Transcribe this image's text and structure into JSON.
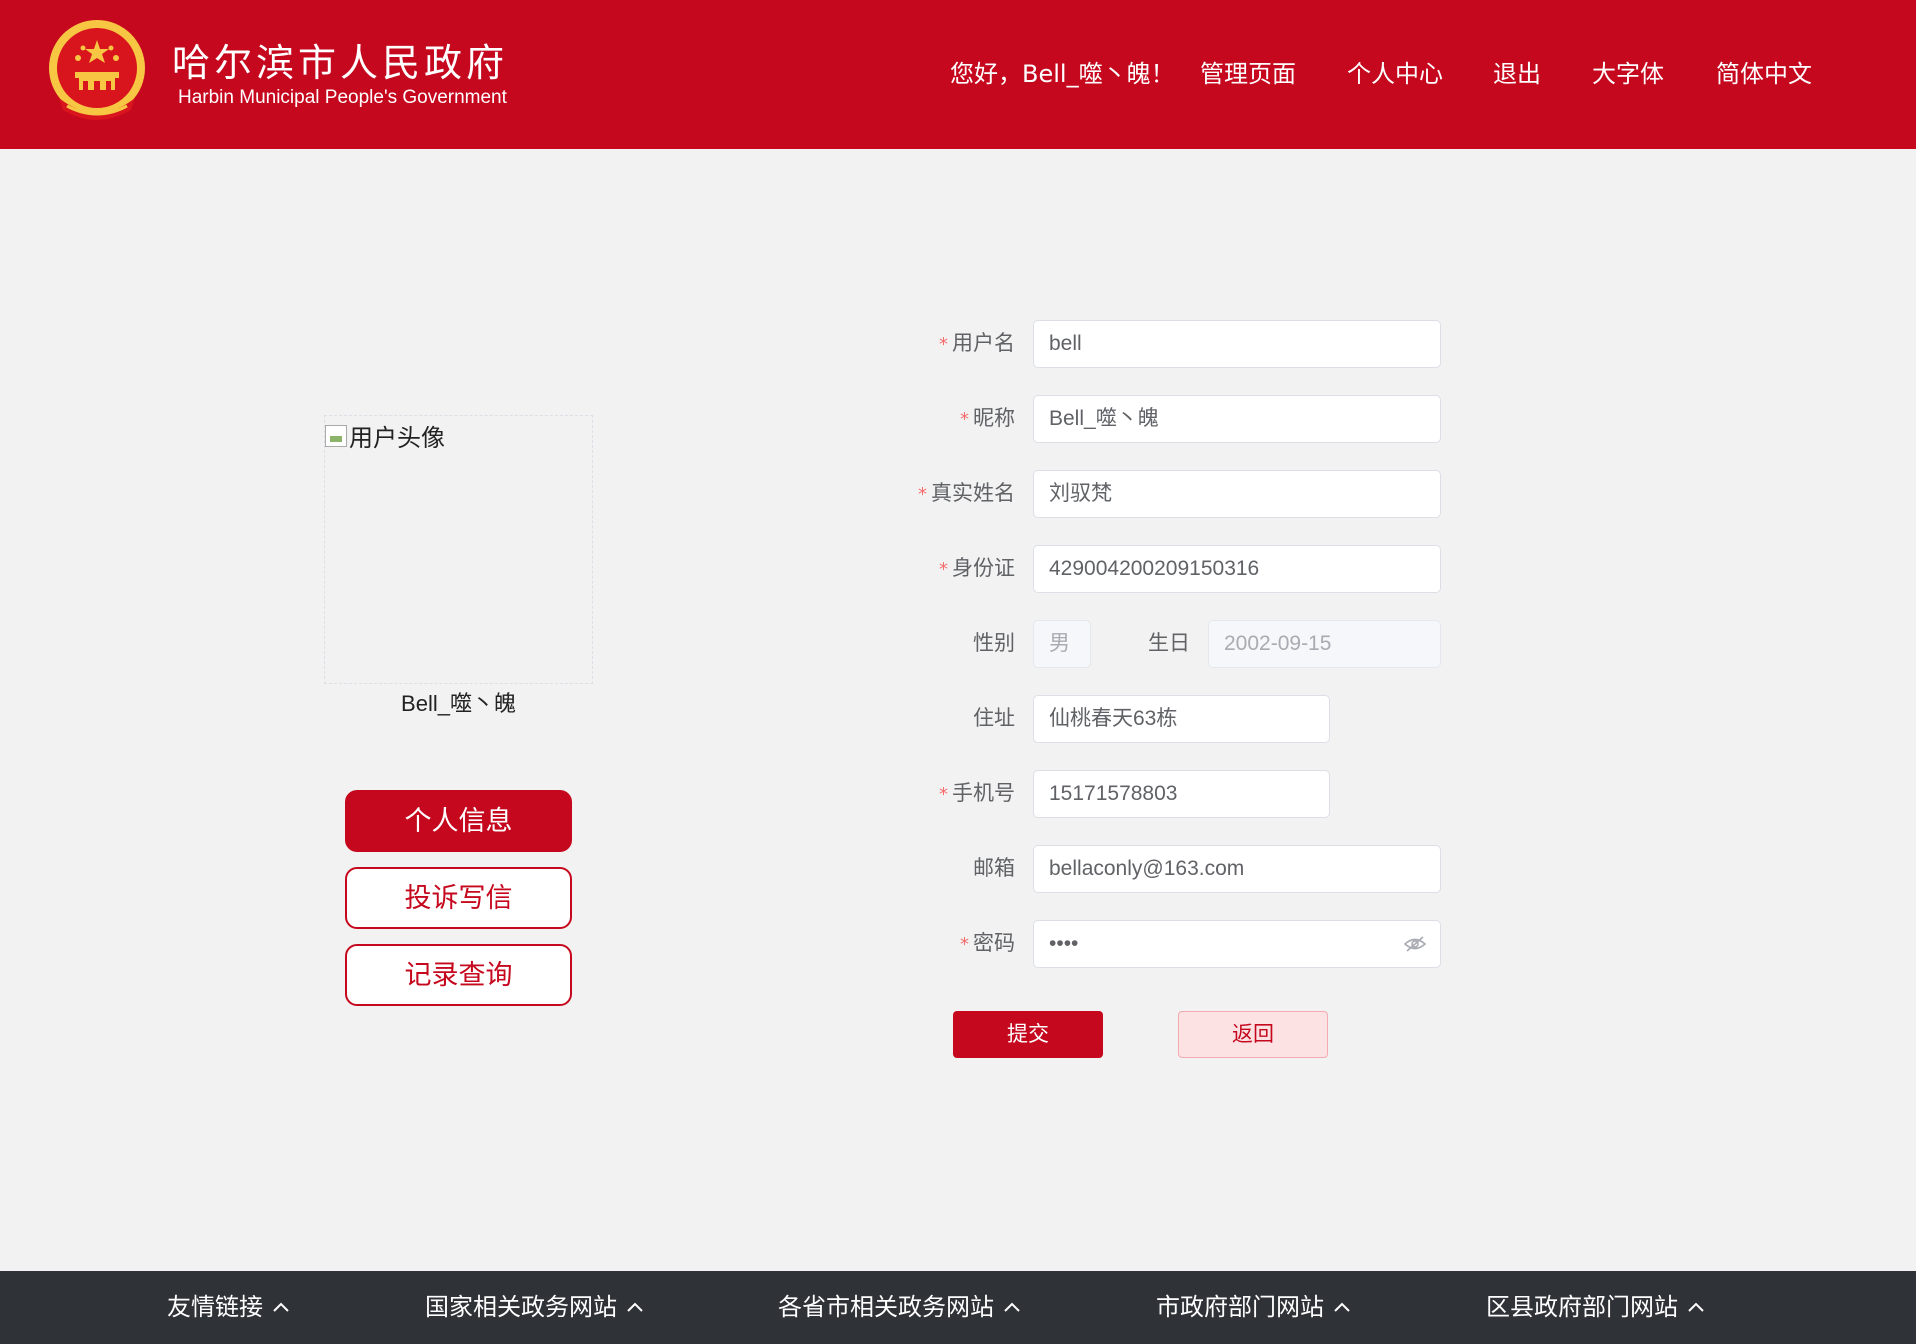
{
  "header": {
    "title": "哈尔滨市人民政府",
    "subtitle": "Harbin Municipal People's Government",
    "greeting": "您好，Bell_噬丶魄！",
    "nav": {
      "admin": "管理页面",
      "personal_center": "个人中心",
      "logout": "退出",
      "large_font": "大字体",
      "language": "简体中文"
    }
  },
  "profile": {
    "avatar_alt": "用户头像",
    "name": "Bell_噬丶魄",
    "menu": {
      "info": "个人信息",
      "complaint": "投诉写信",
      "records": "记录查询"
    }
  },
  "form": {
    "username_label": "用户名",
    "username": "bell",
    "nickname_label": "昵称",
    "nickname": "Bell_噬丶魄",
    "realname_label": "真实姓名",
    "realname": "刘驭梵",
    "idcard_label": "身份证",
    "idcard": "429004200209150316",
    "gender_label": "性别",
    "gender": "男",
    "birthday_label": "生日",
    "birthday": "2002-09-15",
    "address_label": "住址",
    "address": "仙桃春天63栋",
    "phone_label": "手机号",
    "phone": "15171578803",
    "email_label": "邮箱",
    "email": "bellaconly@163.com",
    "password_label": "密码",
    "password_mask": "••••",
    "required_mark": "*",
    "submit": "提交",
    "back": "返回"
  },
  "footer": {
    "links": [
      "友情链接",
      "国家相关政务网站",
      "各省市相关政务网站",
      "市政府部门网站",
      "区县政府部门网站"
    ]
  },
  "colors": {
    "brand_red": "#c5081e",
    "footer_bg": "#2f3237",
    "page_bg": "#f2f2f2"
  }
}
